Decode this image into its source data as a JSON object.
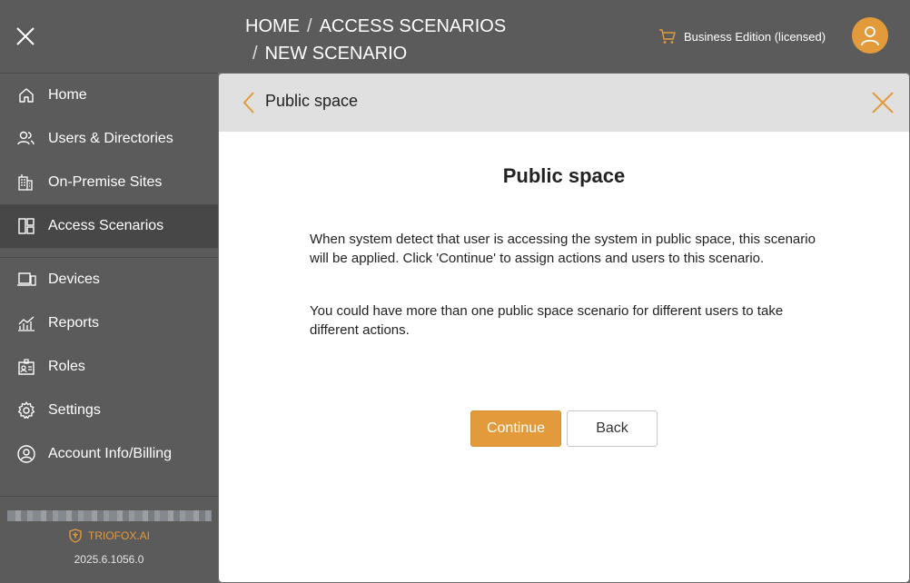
{
  "sidebar": {
    "items": [
      {
        "label": "Home",
        "icon": "home-icon"
      },
      {
        "label": "Users & Directories",
        "icon": "users-icon"
      },
      {
        "label": "On-Premise Sites",
        "icon": "building-icon"
      },
      {
        "label": "Access Scenarios",
        "icon": "layout-icon",
        "active": true
      },
      {
        "label": "Devices",
        "icon": "devices-icon"
      },
      {
        "label": "Reports",
        "icon": "reports-icon"
      },
      {
        "label": "Roles",
        "icon": "roles-icon"
      },
      {
        "label": "Settings",
        "icon": "gear-icon"
      },
      {
        "label": "Account Info/Billing",
        "icon": "account-icon"
      }
    ],
    "brand": "TRIOFOX.AI",
    "version": "2025.6.1056.0"
  },
  "header": {
    "breadcrumb": [
      "HOME",
      "ACCESS SCENARIOS",
      "NEW SCENARIO"
    ],
    "edition": "Business Edition (licensed)"
  },
  "panel": {
    "header_title": "Public space",
    "title": "Public space",
    "paragraphs": [
      "When system detect that user is accessing the system in public space, this scenario will be applied. Click 'Continue' to assign actions and users to this scenario.",
      "You could have more than one public space scenario for different users to take different actions."
    ],
    "continue_label": "Continue",
    "back_label": "Back"
  },
  "colors": {
    "accent": "#e39a3b",
    "sidebar_bg": "#5b5b5b",
    "active_item_bg": "#474747",
    "panel_header_bg": "#e0e0e0"
  }
}
